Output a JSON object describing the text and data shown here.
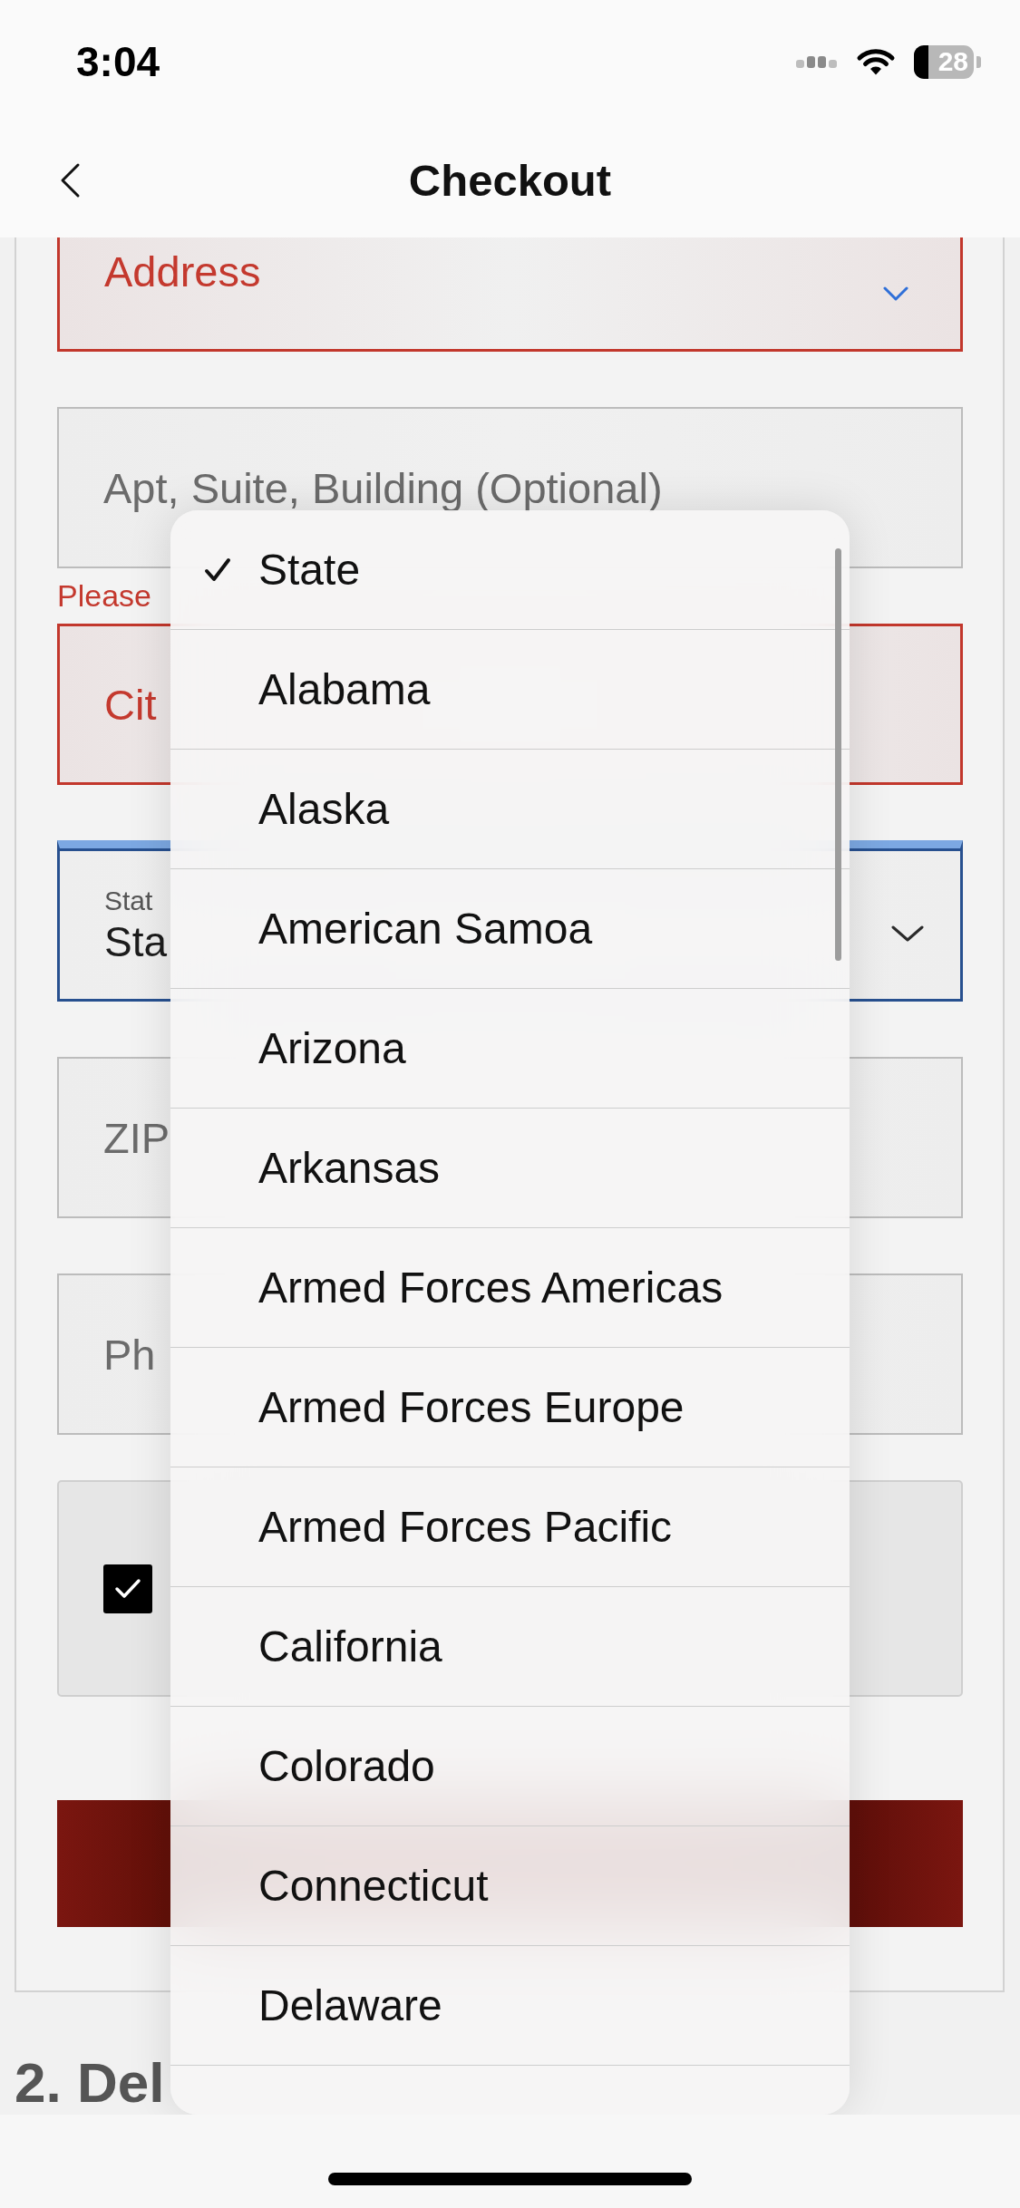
{
  "status_bar": {
    "time": "3:04",
    "battery": "28"
  },
  "header": {
    "title": "Checkout"
  },
  "form": {
    "items": [
      {
        "kind": "select",
        "placeholder": "Address",
        "invalid": true,
        "focused": false
      },
      {
        "kind": "text",
        "placeholder": "Apt, Suite, Building (Optional)",
        "invalid": false,
        "focused": false
      },
      {
        "kind": "error_message",
        "text": "Please"
      },
      {
        "kind": "text",
        "placeholder": "Cit",
        "invalid": true,
        "focused": false
      },
      {
        "kind": "select",
        "label": "Stat",
        "value": "Sta",
        "invalid": false,
        "focused": true
      },
      {
        "kind": "text",
        "placeholder": "ZIP",
        "invalid": false,
        "focused": false
      },
      {
        "kind": "text",
        "placeholder": "Ph",
        "invalid": false,
        "focused": false
      },
      {
        "kind": "checkbox",
        "checked": true
      },
      {
        "kind": "button"
      }
    ]
  },
  "next_section": {
    "title": "2. Del"
  },
  "state_menu": {
    "options": [
      {
        "label": "State",
        "selected": true
      },
      {
        "label": "Alabama",
        "selected": false
      },
      {
        "label": "Alaska",
        "selected": false
      },
      {
        "label": "American Samoa",
        "selected": false
      },
      {
        "label": "Arizona",
        "selected": false
      },
      {
        "label": "Arkansas",
        "selected": false
      },
      {
        "label": "Armed Forces Americas",
        "selected": false
      },
      {
        "label": "Armed Forces Europe",
        "selected": false
      },
      {
        "label": "Armed Forces Pacific",
        "selected": false
      },
      {
        "label": "California",
        "selected": false
      },
      {
        "label": "Colorado",
        "selected": false
      },
      {
        "label": "Connecticut",
        "selected": false
      },
      {
        "label": "Delaware",
        "selected": false
      }
    ]
  }
}
